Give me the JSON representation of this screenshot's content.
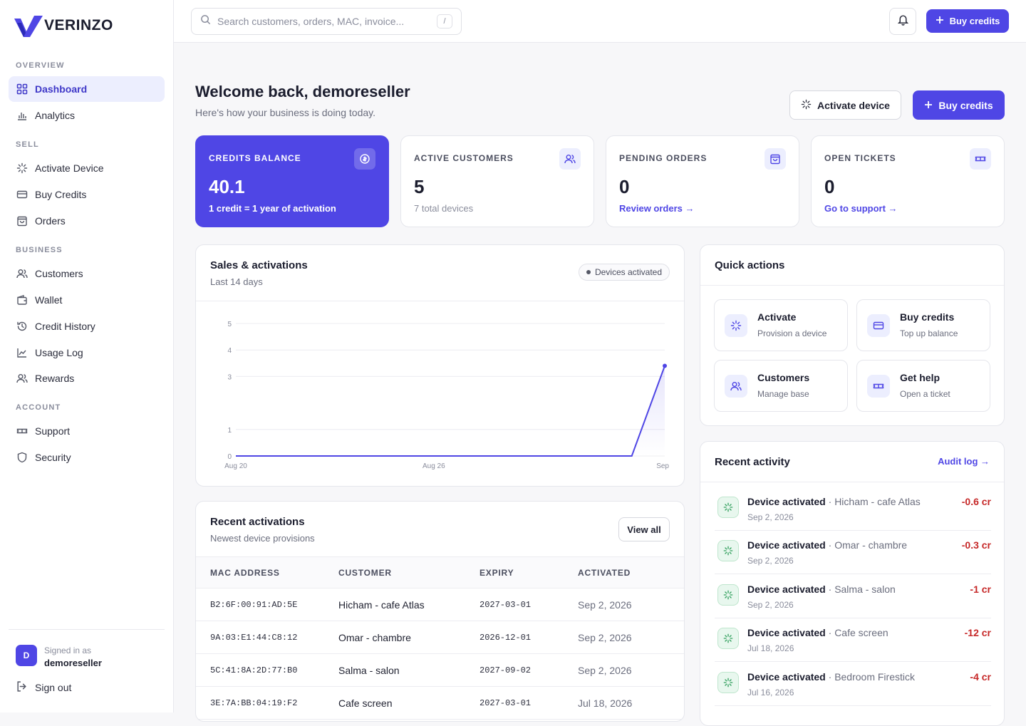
{
  "brand": {
    "name": "VERINZO",
    "accent": "#4f46e5"
  },
  "sidebar": {
    "sections": [
      {
        "label": "OVERVIEW",
        "items": [
          {
            "label": "Dashboard",
            "icon": "grid-icon",
            "active": true
          },
          {
            "label": "Analytics",
            "icon": "bar-chart-icon"
          }
        ]
      },
      {
        "label": "SELL",
        "items": [
          {
            "label": "Activate Device",
            "icon": "spinner-icon"
          },
          {
            "label": "Buy Credits",
            "icon": "card-icon"
          },
          {
            "label": "Orders",
            "icon": "bag-icon"
          }
        ]
      },
      {
        "label": "BUSINESS",
        "items": [
          {
            "label": "Customers",
            "icon": "users-icon"
          },
          {
            "label": "Wallet",
            "icon": "wallet-icon"
          },
          {
            "label": "Credit History",
            "icon": "history-icon"
          },
          {
            "label": "Usage Log",
            "icon": "line-chart-icon"
          },
          {
            "label": "Rewards",
            "icon": "users-icon"
          }
        ]
      },
      {
        "label": "ACCOUNT",
        "items": [
          {
            "label": "Support",
            "icon": "ticket-icon"
          },
          {
            "label": "Security",
            "icon": "shield-icon"
          }
        ]
      }
    ],
    "signed_in_label": "Signed in as",
    "user": "demoreseller",
    "avatar_letter": "D",
    "sign_out": "Sign out"
  },
  "topbar": {
    "search_placeholder": "Search customers, orders, MAC, invoice...",
    "shortcut": "/",
    "buy_label": "Buy credits"
  },
  "header": {
    "title": "Welcome back, demoreseller",
    "subtitle": "Here's how your business is doing today.",
    "activate_label": "Activate device",
    "buy_label": "Buy credits"
  },
  "stats": {
    "credits": {
      "title": "CREDITS BALANCE",
      "value": "40.1",
      "sub": "1 credit = 1 year of activation"
    },
    "customers": {
      "title": "ACTIVE CUSTOMERS",
      "value": "5",
      "sub": "7 total devices"
    },
    "orders": {
      "title": "PENDING ORDERS",
      "value": "0",
      "link": "Review orders →"
    },
    "tickets": {
      "title": "OPEN TICKETS",
      "value": "0",
      "link": "Go to support →"
    }
  },
  "sales": {
    "title": "Sales & activations",
    "subtitle": "Last 14 days",
    "legend": "Devices activated"
  },
  "chart_data": {
    "type": "area",
    "title": "Sales & activations",
    "subtitle": "Last 14 days",
    "x": [
      "Aug 20",
      "Aug 21",
      "Aug 22",
      "Aug 23",
      "Aug 24",
      "Aug 25",
      "Aug 26",
      "Aug 27",
      "Aug 28",
      "Aug 29",
      "Aug 30",
      "Aug 31",
      "Sep 1",
      "Sep 2"
    ],
    "x_tick_labels": [
      "Aug 20",
      "Aug 26",
      "Sep"
    ],
    "series": [
      {
        "name": "Devices activated",
        "values": [
          0,
          0,
          0,
          0,
          0,
          0,
          0,
          0,
          0,
          0,
          0,
          0,
          0,
          3.4
        ]
      }
    ],
    "y_ticks": [
      0,
      1,
      3,
      4,
      5
    ],
    "ylim": [
      0,
      5
    ],
    "grid": true,
    "legend": "top-right",
    "color": "#4f46e5"
  },
  "activations": {
    "title": "Recent activations",
    "subtitle": "Newest device provisions",
    "view_all": "View all",
    "columns": [
      "MAC ADDRESS",
      "CUSTOMER",
      "EXPIRY",
      "ACTIVATED"
    ],
    "rows": [
      [
        "B2:6F:00:91:AD:5E",
        "Hicham - cafe Atlas",
        "2027-03-01",
        "Sep 2, 2026"
      ],
      [
        "9A:03:E1:44:C8:12",
        "Omar - chambre",
        "2026-12-01",
        "Sep 2, 2026"
      ],
      [
        "5C:41:8A:2D:77:B0",
        "Salma - salon",
        "2027-09-02",
        "Sep 2, 2026"
      ],
      [
        "3E:7A:BB:04:19:F2",
        "Cafe screen",
        "2027-03-01",
        "Jul 18, 2026"
      ]
    ]
  },
  "quick_actions": {
    "title": "Quick actions",
    "items": [
      {
        "title": "Activate",
        "sub": "Provision a device",
        "icon": "spinner-icon"
      },
      {
        "title": "Buy credits",
        "sub": "Top up balance",
        "icon": "card-icon"
      },
      {
        "title": "Customers",
        "sub": "Manage base",
        "icon": "users-icon"
      },
      {
        "title": "Get help",
        "sub": "Open a ticket",
        "icon": "ticket-icon"
      }
    ]
  },
  "activity": {
    "title": "Recent activity",
    "link": "Audit log →",
    "items": [
      {
        "event": "Device activated",
        "target": "Hicham - cafe Atlas",
        "date": "Sep 2, 2026",
        "amount": "-0.6 cr"
      },
      {
        "event": "Device activated",
        "target": "Omar - chambre",
        "date": "Sep 2, 2026",
        "amount": "-0.3 cr"
      },
      {
        "event": "Device activated",
        "target": "Salma - salon",
        "date": "Sep 2, 2026",
        "amount": "-1 cr"
      },
      {
        "event": "Device activated",
        "target": "Cafe screen",
        "date": "Jul 18, 2026",
        "amount": "-12 cr"
      },
      {
        "event": "Device activated",
        "target": "Bedroom Firestick",
        "date": "Jul 16, 2026",
        "amount": "-4 cr"
      }
    ]
  }
}
